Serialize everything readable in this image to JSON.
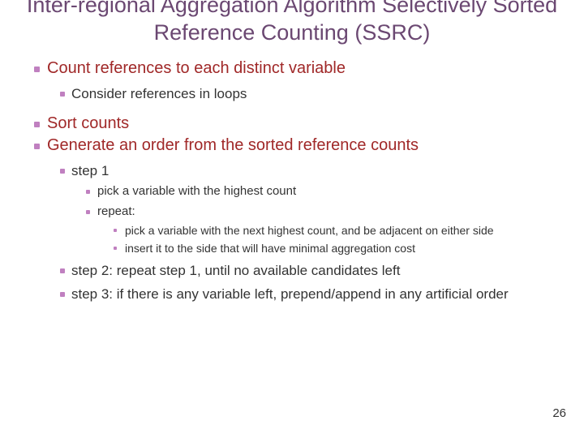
{
  "title": "Inter-regional Aggregation Algorithm Selectively Sorted Reference Counting (SSRC)",
  "bullets": {
    "b1": "Count references to each distinct variable",
    "b1_1": "Consider references in loops",
    "b2": "Sort counts",
    "b3": "Generate an order from the sorted reference counts",
    "b3_1": "step 1",
    "b3_1_1": "pick a variable with the highest count",
    "b3_1_2": "repeat:",
    "b3_1_2_1": "pick a variable with the next highest count, and be adjacent on either side",
    "b3_1_2_2": "insert it to the side that will have minimal aggregation cost",
    "b3_2": "step 2: repeat step 1, until no available candidates left",
    "b3_3": "step 3: if there is any variable left, prepend/append in any artificial order"
  },
  "page_number": "26"
}
